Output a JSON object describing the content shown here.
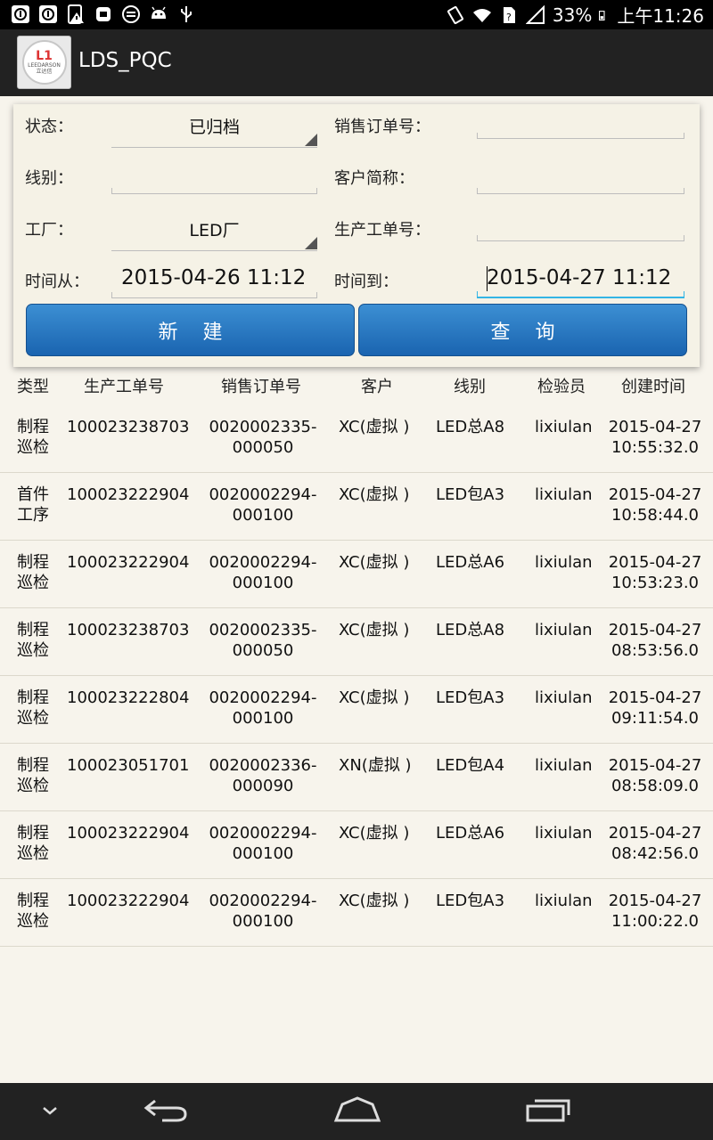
{
  "status_bar": {
    "battery": "33%",
    "time": "上午11:26"
  },
  "app": {
    "title": "LDS_PQC",
    "logo_text": "LEEDARSON",
    "logo_cn": "立达信",
    "logo_mark": "L1"
  },
  "form": {
    "status_label": "状态：",
    "status_value": "已归档",
    "sales_order_label": "销售订单号：",
    "sales_order_value": "",
    "line_label": "线别：",
    "line_value": "",
    "customer_label": "客户简称：",
    "customer_value": "",
    "factory_label": "工厂：",
    "factory_value": "LED厂",
    "work_order_label": "生产工单号：",
    "work_order_value": "",
    "time_from_label": "时间从：",
    "time_from_value": "2015-04-26  11:12",
    "time_to_label": "时间到：",
    "time_to_value": "2015-04-27  11:12",
    "new_button": "新建",
    "query_button": "查询"
  },
  "table": {
    "headers": [
      "类型",
      "生产工单号",
      "销售订单号",
      "客户",
      "线别",
      "检验员",
      "创建时间"
    ],
    "rows": [
      {
        "type": "制程巡检",
        "prod": "100023238703",
        "sale": "0020002335-000050",
        "cust": "XC(虚拟 )",
        "line": "LED总A8",
        "insp": "lixiulan",
        "time_d": "2015-04-27",
        "time_t": "10:55:32.0"
      },
      {
        "type": "首件工序",
        "prod": "100023222904",
        "sale": "0020002294-000100",
        "cust": "XC(虚拟 )",
        "line": "LED包A3",
        "insp": "lixiulan",
        "time_d": "2015-04-27",
        "time_t": "10:58:44.0"
      },
      {
        "type": "制程巡检",
        "prod": "100023222904",
        "sale": "0020002294-000100",
        "cust": "XC(虚拟 )",
        "line": "LED总A6",
        "insp": "lixiulan",
        "time_d": "2015-04-27",
        "time_t": "10:53:23.0"
      },
      {
        "type": "制程巡检",
        "prod": "100023238703",
        "sale": "0020002335-000050",
        "cust": "XC(虚拟 )",
        "line": "LED总A8",
        "insp": "lixiulan",
        "time_d": "2015-04-27",
        "time_t": "08:53:56.0"
      },
      {
        "type": "制程巡检",
        "prod": "100023222804",
        "sale": "0020002294-000100",
        "cust": "XC(虚拟 )",
        "line": "LED包A3",
        "insp": "lixiulan",
        "time_d": "2015-04-27",
        "time_t": "09:11:54.0"
      },
      {
        "type": "制程巡检",
        "prod": "100023051701",
        "sale": "0020002336-000090",
        "cust": "XN(虚拟 )",
        "line": "LED包A4",
        "insp": "lixiulan",
        "time_d": "2015-04-27",
        "time_t": "08:58:09.0"
      },
      {
        "type": "制程巡检",
        "prod": "100023222904",
        "sale": "0020002294-000100",
        "cust": "XC(虚拟 )",
        "line": "LED总A6",
        "insp": "lixiulan",
        "time_d": "2015-04-27",
        "time_t": "08:42:56.0"
      },
      {
        "type": "制程巡检",
        "prod": "100023222904",
        "sale": "0020002294-000100",
        "cust": "XC(虚拟 )",
        "line": "LED包A3",
        "insp": "lixiulan",
        "time_d": "2015-04-27",
        "time_t": "11:00:22.0"
      }
    ]
  },
  "icons": {
    "status_left": [
      "notification-icon",
      "notification-icon",
      "warning-icon",
      "app-icon",
      "sync-icon",
      "android-icon",
      "usb-icon"
    ],
    "status_right": [
      "vibrate-icon",
      "wifi-icon",
      "sim-icon",
      "signal-icon",
      "battery-icon"
    ],
    "nav": [
      "hide-keyboard-icon",
      "back-icon",
      "home-icon",
      "recent-apps-icon"
    ]
  },
  "colors": {
    "button_blue": "#1a64b0",
    "focus_blue": "#33b5e5",
    "background": "#f7f4ec"
  }
}
